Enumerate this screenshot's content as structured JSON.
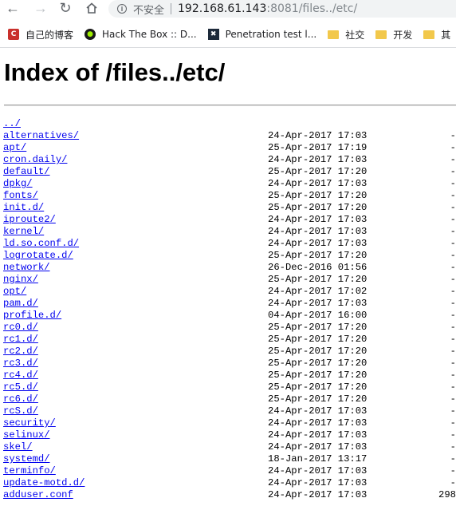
{
  "browser": {
    "security_label": "不安全",
    "url_host": "192.168.61.143",
    "url_rest": ":8081/files../etc/"
  },
  "bookmarks": [
    {
      "label": "自己的博客",
      "icon": "csdn-icon"
    },
    {
      "label": "Hack The Box :: D...",
      "icon": "hackthebox-icon"
    },
    {
      "label": "Penetration test l...",
      "icon": "penetration-icon"
    },
    {
      "label": "社交",
      "icon": "folder-icon"
    },
    {
      "label": "开发",
      "icon": "folder-icon"
    },
    {
      "label": "其",
      "icon": "folder-icon"
    }
  ],
  "page": {
    "title": "Index of /files../etc/"
  },
  "entries": [
    {
      "name": "../",
      "date": "",
      "size": ""
    },
    {
      "name": "alternatives/",
      "date": "24-Apr-2017 17:03",
      "size": "-"
    },
    {
      "name": "apt/",
      "date": "25-Apr-2017 17:19",
      "size": "-"
    },
    {
      "name": "cron.daily/",
      "date": "24-Apr-2017 17:03",
      "size": "-"
    },
    {
      "name": "default/",
      "date": "25-Apr-2017 17:20",
      "size": "-"
    },
    {
      "name": "dpkg/",
      "date": "24-Apr-2017 17:03",
      "size": "-"
    },
    {
      "name": "fonts/",
      "date": "25-Apr-2017 17:20",
      "size": "-"
    },
    {
      "name": "init.d/",
      "date": "25-Apr-2017 17:20",
      "size": "-"
    },
    {
      "name": "iproute2/",
      "date": "24-Apr-2017 17:03",
      "size": "-"
    },
    {
      "name": "kernel/",
      "date": "24-Apr-2017 17:03",
      "size": "-"
    },
    {
      "name": "ld.so.conf.d/",
      "date": "24-Apr-2017 17:03",
      "size": "-"
    },
    {
      "name": "logrotate.d/",
      "date": "25-Apr-2017 17:20",
      "size": "-"
    },
    {
      "name": "network/",
      "date": "26-Dec-2016 01:56",
      "size": "-"
    },
    {
      "name": "nginx/",
      "date": "25-Apr-2017 17:20",
      "size": "-"
    },
    {
      "name": "opt/",
      "date": "24-Apr-2017 17:02",
      "size": "-"
    },
    {
      "name": "pam.d/",
      "date": "24-Apr-2017 17:03",
      "size": "-"
    },
    {
      "name": "profile.d/",
      "date": "04-Apr-2017 16:00",
      "size": "-"
    },
    {
      "name": "rc0.d/",
      "date": "25-Apr-2017 17:20",
      "size": "-"
    },
    {
      "name": "rc1.d/",
      "date": "25-Apr-2017 17:20",
      "size": "-"
    },
    {
      "name": "rc2.d/",
      "date": "25-Apr-2017 17:20",
      "size": "-"
    },
    {
      "name": "rc3.d/",
      "date": "25-Apr-2017 17:20",
      "size": "-"
    },
    {
      "name": "rc4.d/",
      "date": "25-Apr-2017 17:20",
      "size": "-"
    },
    {
      "name": "rc5.d/",
      "date": "25-Apr-2017 17:20",
      "size": "-"
    },
    {
      "name": "rc6.d/",
      "date": "25-Apr-2017 17:20",
      "size": "-"
    },
    {
      "name": "rcS.d/",
      "date": "24-Apr-2017 17:03",
      "size": "-"
    },
    {
      "name": "security/",
      "date": "24-Apr-2017 17:03",
      "size": "-"
    },
    {
      "name": "selinux/",
      "date": "24-Apr-2017 17:03",
      "size": "-"
    },
    {
      "name": "skel/",
      "date": "24-Apr-2017 17:03",
      "size": "-"
    },
    {
      "name": "systemd/",
      "date": "18-Jan-2017 13:17",
      "size": "-"
    },
    {
      "name": "terminfo/",
      "date": "24-Apr-2017 17:03",
      "size": "-"
    },
    {
      "name": "update-motd.d/",
      "date": "24-Apr-2017 17:03",
      "size": "-"
    },
    {
      "name": "adduser.conf",
      "date": "24-Apr-2017 17:03",
      "size": "298"
    }
  ]
}
